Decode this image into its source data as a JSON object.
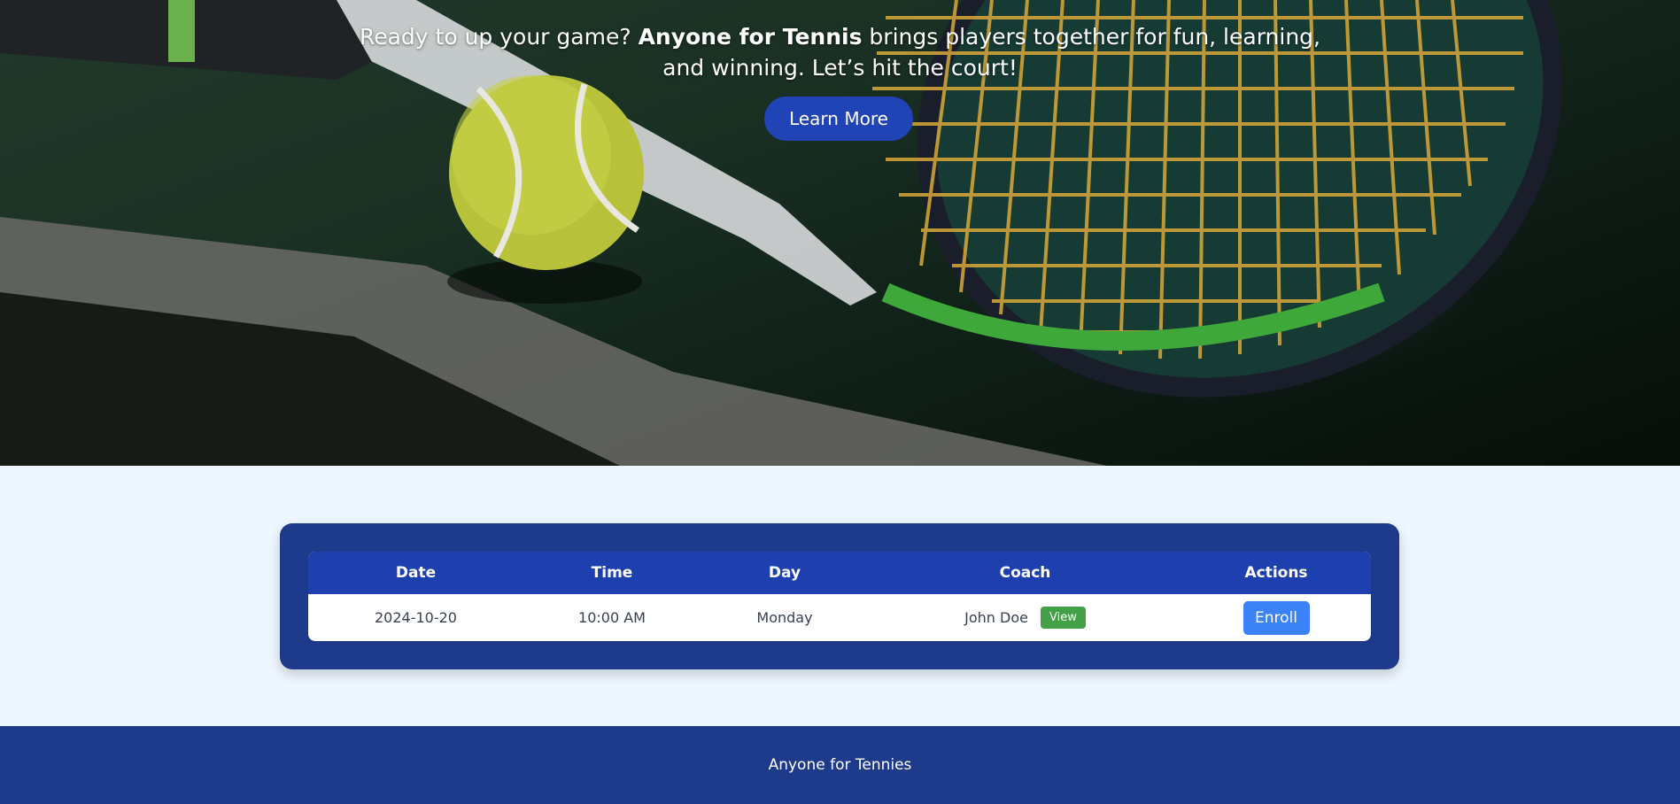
{
  "hero": {
    "text_before": "Ready to up your game? ",
    "brand": "Anyone for Tennis",
    "text_after": " brings players together for fun, learning,",
    "line2": "and winning. Let’s hit the court!",
    "learn_more": "Learn More"
  },
  "table": {
    "headers": [
      "Date",
      "Time",
      "Day",
      "Coach",
      "Actions"
    ],
    "rows": [
      {
        "date": "2024-10-20",
        "time": "10:00 AM",
        "day": "Monday",
        "coach": "John Doe",
        "view_label": "View",
        "enroll_label": "Enroll"
      }
    ]
  },
  "footer": {
    "text": "Anyone for Tennies"
  },
  "colors": {
    "primary": "#1e3a8a",
    "header": "#1e40af",
    "enroll": "#3b82f6",
    "view": "#43a047",
    "page_bg": "#eef6ff"
  }
}
